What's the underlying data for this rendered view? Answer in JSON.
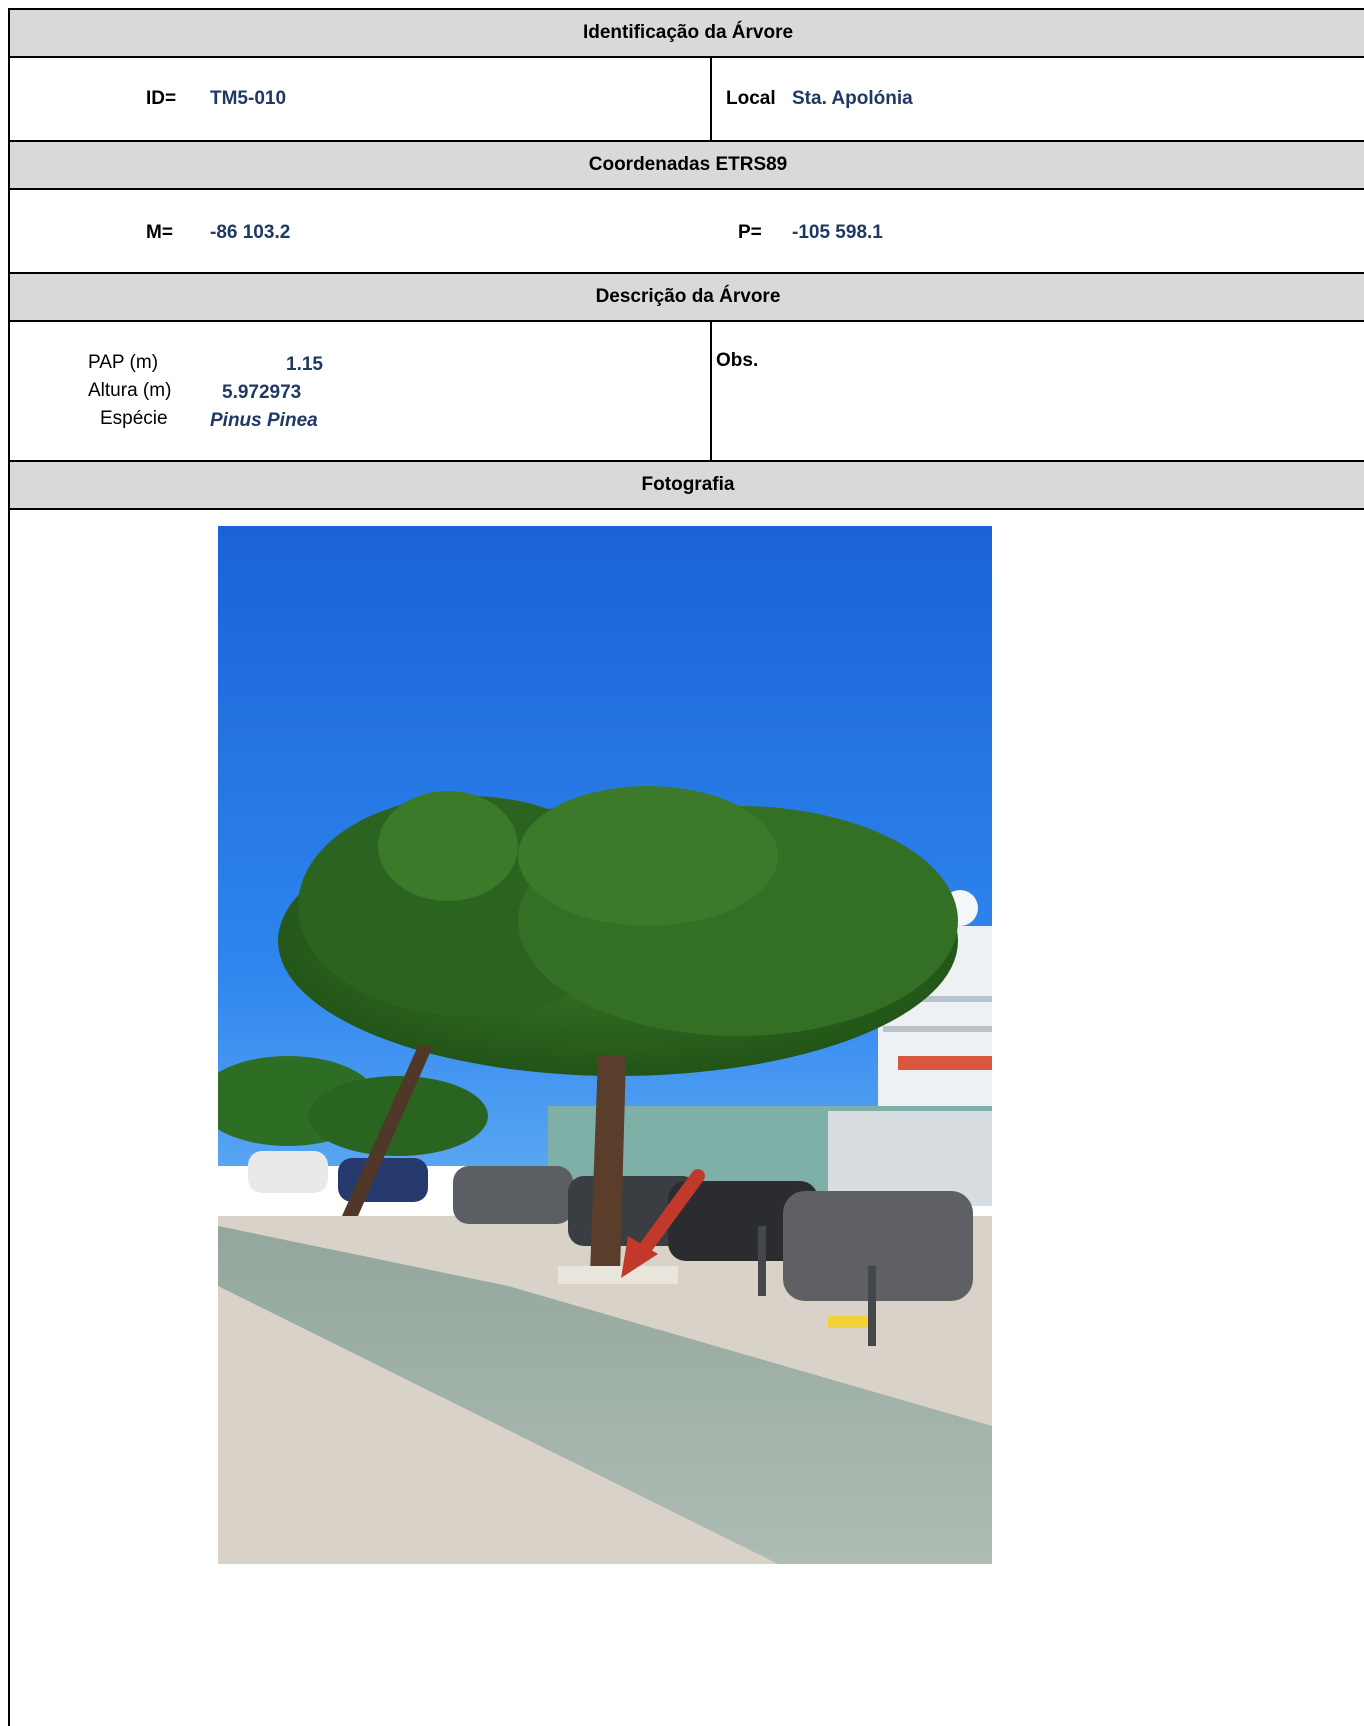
{
  "identificacao": {
    "header": "Identificação da Árvore",
    "id_label": "ID=",
    "id_value": "TM5-010",
    "local_label": "Local",
    "local_value": "Sta. Apolónia"
  },
  "coordenadas": {
    "header": "Coordenadas ETRS89",
    "m_label": "M=",
    "m_value": "-86 103.2",
    "p_label": "P=",
    "p_value": "-105 598.1"
  },
  "descricao": {
    "header": "Descrição da Árvore",
    "pap_label": "PAP (m)",
    "pap_value": "1.15",
    "altura_label": "Altura (m)",
    "altura_value": "5.972973",
    "especie_label": "Espécie",
    "especie_value": "Pinus Pinea",
    "obs_label": "Obs."
  },
  "fotografia": {
    "header": "Fotografia"
  },
  "colors": {
    "header_bg": "#d9d9d9",
    "value_text": "#1f3864",
    "arrow": "#c0392b"
  }
}
